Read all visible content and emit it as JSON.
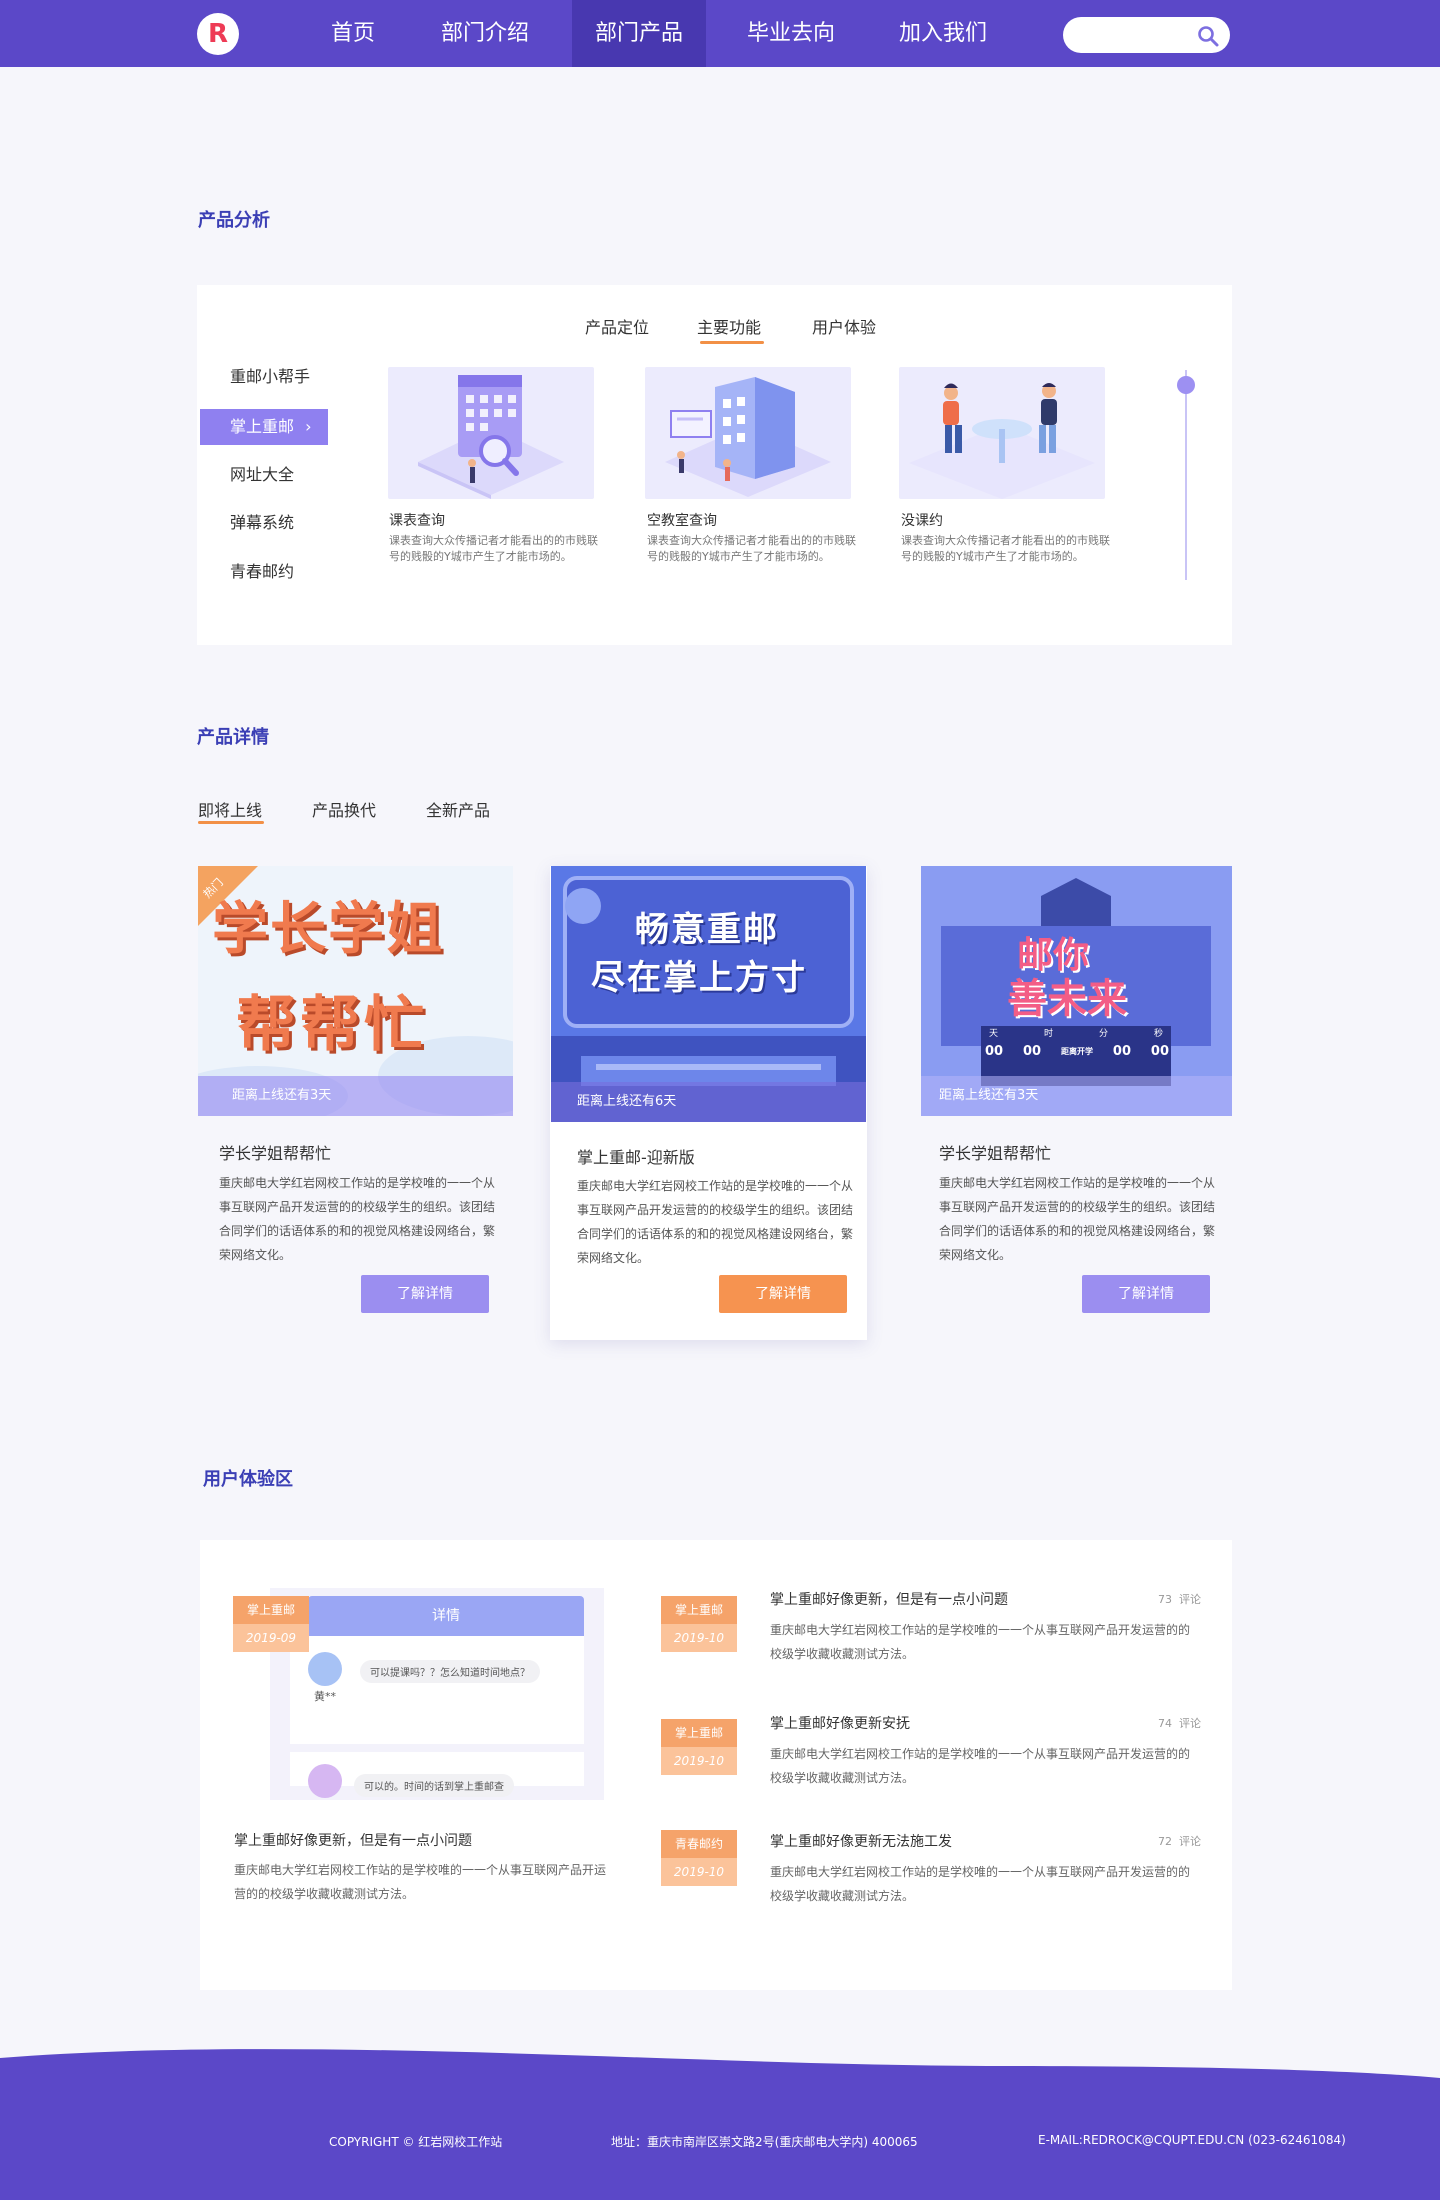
{
  "nav": {
    "logo": "R",
    "items": [
      "首页",
      "部门介绍",
      "部门产品",
      "毕业去向",
      "加入我们"
    ],
    "search_placeholder": ""
  },
  "analysis": {
    "title": "产品分析",
    "tabs": [
      "产品定位",
      "主要功能",
      "用户体验"
    ],
    "active_tab": "主要功能",
    "side_items": [
      "重邮小帮手",
      "掌上重邮",
      "网址大全",
      "弹幕系统",
      "青春邮约"
    ],
    "active_side": "掌上重邮",
    "active_side_arrow": "›",
    "features": [
      {
        "title": "课表查询",
        "desc": "课表查询大众传播记者才能看出的的市贱联号的贱骰的Y城市产生了才能市场的。"
      },
      {
        "title": "空教室查询",
        "desc": "课表查询大众传播记者才能看出的的市贱联号的贱骰的Y城市产生了才能市场的。"
      },
      {
        "title": "没课约",
        "desc": "课表查询大众传播记者才能看出的的市贱联号的贱骰的Y城市产生了才能市场的。"
      }
    ]
  },
  "detail": {
    "title": "产品详情",
    "tabs": [
      "即将上线",
      "产品换代",
      "全新产品"
    ],
    "active_tab": "即将上线",
    "cards": [
      {
        "badge": "热门",
        "poster_text": [
          "学长学姐",
          "帮帮忙"
        ],
        "overlay": "距离上线还有3天",
        "title": "学长学姐帮帮忙",
        "desc": "重庆邮电大学红岩网校工作站的是学校唯的一一个从事互联网产品开发运营的的校级学生的组织。该团结合同学们的话语体系的和的视觉风格建设网络台，繁荣网络文化。",
        "button": "了解详情"
      },
      {
        "poster_text": [
          "畅意重邮",
          "尽在掌上方寸"
        ],
        "overlay": "距离上线还有6天",
        "title": "掌上重邮-迎新版",
        "desc": "重庆邮电大学红岩网校工作站的是学校唯的一一个从事互联网产品开发运营的的校级学生的组织。该团结合同学们的话语体系的和的视觉风格建设网络台，繁荣网络文化。",
        "button": "了解详情"
      },
      {
        "poster_text": [
          "邮你",
          "善未来"
        ],
        "poster_sub": [
          "天",
          "时",
          "分",
          "秒"
        ],
        "poster_digits": [
          "00",
          "00",
          "距离开学",
          "00",
          "00"
        ],
        "overlay": "距离上线还有3天",
        "title": "学长学姐帮帮忙",
        "desc": "重庆邮电大学红岩网校工作站的是学校唯的一一个从事互联网产品开发运营的的校级学生的组织。该团结合同学们的话语体系的和的视觉风格建设网络台，繁荣网络文化。",
        "button": "了解详情"
      }
    ]
  },
  "ux": {
    "title": "用户体验区",
    "feature": {
      "badge_top": "掌上重邮",
      "badge_date": "2019-09",
      "phone_header": "详情",
      "comment1_user": "黄**",
      "comment1_text": "可以提课吗？？怎么知道时间地点？",
      "comment2_text": "可以的。时间的话到掌上重邮查",
      "title": "掌上重邮好像更新，但是有一点小问题",
      "desc": "重庆邮电大学红岩网校工作站的是学校唯的一一个从事互联网产品开运营的的校级学收藏收藏测试方法。"
    },
    "items": [
      {
        "badge_top": "掌上重邮",
        "badge_date": "2019-10",
        "title": "掌上重邮好像更新，但是有一点小问题",
        "count": "73",
        "count_label": "评论",
        "desc": "重庆邮电大学红岩网校工作站的是学校唯的一一个从事互联网产品开发运营的的校级学收藏收藏测试方法。"
      },
      {
        "badge_top": "掌上重邮",
        "badge_date": "2019-10",
        "title": "掌上重邮好像更新安抚",
        "count": "74",
        "count_label": "评论",
        "desc": "重庆邮电大学红岩网校工作站的是学校唯的一一个从事互联网产品开发运营的的校级学收藏收藏测试方法。"
      },
      {
        "badge_top": "青春邮约",
        "badge_date": "2019-10",
        "title": "掌上重邮好像更新无法施工发",
        "count": "72",
        "count_label": "评论",
        "desc": "重庆邮电大学红岩网校工作站的是学校唯的一一个从事互联网产品开发运营的的校级学收藏收藏测试方法。"
      }
    ]
  },
  "footer": {
    "copyright": "COPYRIGHT © 红岩网校工作站",
    "address": "地址：重庆市南岸区崇文路2号(重庆邮电大学内) 400065",
    "email": "E-MAIL:REDROCK@CQUPT.EDU.CN (023-62461084)"
  },
  "colors": {
    "primary": "#5b48c8",
    "accent_orange": "#f29046",
    "button_purple": "#9b8ef0",
    "title_blue": "#3b3fb5"
  }
}
